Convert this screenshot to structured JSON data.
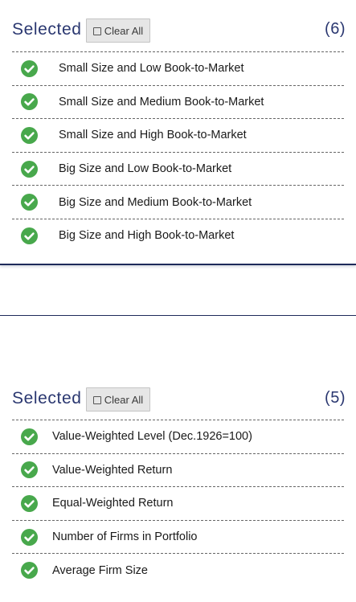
{
  "sections": [
    {
      "title": "Selected",
      "clear_label": "Clear All",
      "count": "(6)",
      "items": [
        {
          "label": "Small Size and Low Book-to-Market"
        },
        {
          "label": "Small Size and Medium Book-to-Market"
        },
        {
          "label": "Small Size and High Book-to-Market"
        },
        {
          "label": "Big Size and Low Book-to-Market"
        },
        {
          "label": "Big Size and Medium Book-to-Market"
        },
        {
          "label": "Big Size and High Book-to-Market"
        }
      ]
    },
    {
      "title": "Selected",
      "clear_label": "Clear All",
      "count": "(5)",
      "items": [
        {
          "label": "Value-Weighted Level (Dec.1926=100)"
        },
        {
          "label": "Value-Weighted Return"
        },
        {
          "label": "Equal-Weighted Return"
        },
        {
          "label": "Number of Firms in Portfolio"
        },
        {
          "label": "Average Firm Size"
        }
      ]
    }
  ],
  "icons": {
    "item_icon": "check-circle-icon",
    "clear_icon": "square-outline-icon"
  },
  "colors": {
    "accent": "#2a3770",
    "check": "#48a84c",
    "divider": "#1e2a5a"
  }
}
